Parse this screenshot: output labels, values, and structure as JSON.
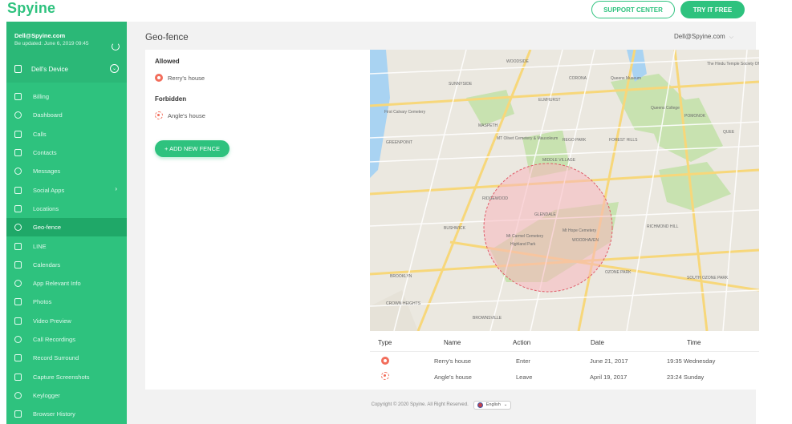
{
  "header": {
    "logo": "Spyine",
    "support_label": "SUPPORT CENTER",
    "try_label": "TRY IT FREE",
    "brand_color": "#2ec27e"
  },
  "sidebar": {
    "email": "Dell@Spyine.com",
    "updated": "Be updated: June 6, 2019 09:45",
    "device": "Dell's Device",
    "items": [
      {
        "label": "Billing",
        "icon": "billing-icon"
      },
      {
        "label": "Dashboard",
        "icon": "dashboard-icon"
      },
      {
        "label": "Calls",
        "icon": "phone-icon"
      },
      {
        "label": "Contacts",
        "icon": "contacts-icon"
      },
      {
        "label": "Messages",
        "icon": "message-icon"
      },
      {
        "label": "Social Apps",
        "icon": "social-icon"
      },
      {
        "label": "Locations",
        "icon": "location-icon"
      },
      {
        "label": "Geo-fence",
        "icon": "geofence-icon"
      },
      {
        "label": "LINE",
        "icon": "line-icon"
      },
      {
        "label": "Calendars",
        "icon": "calendar-icon"
      },
      {
        "label": "App Relevant Info",
        "icon": "apps-icon"
      },
      {
        "label": "Photos",
        "icon": "photo-icon"
      },
      {
        "label": "Video Preview",
        "icon": "video-icon"
      },
      {
        "label": "Call Recordings",
        "icon": "microphone-icon"
      },
      {
        "label": "Record Surround",
        "icon": "record-icon"
      },
      {
        "label": "Capture Screenshots",
        "icon": "screenshot-icon"
      },
      {
        "label": "Keylogger",
        "icon": "keyboard-icon"
      },
      {
        "label": "Browser History",
        "icon": "browser-icon"
      }
    ],
    "active_index": 7
  },
  "main": {
    "title": "Geo-fence",
    "user": "Dell@Spyine.com",
    "allowed_title": "Allowed",
    "allowed": [
      "Rerry's house"
    ],
    "forbidden_title": "Forbidden",
    "forbidden": [
      "Angle's house"
    ],
    "add_fence_label": "+ ADD NEW FENCE"
  },
  "map": {
    "labels": [
      "WOODSIDE",
      "SUNNYSIDE",
      "CORONA",
      "Queens Museum",
      "ELMHURST",
      "First Calvary Cemetery",
      "MASPETH",
      "GREENPOINT",
      "MT Olivet Cemetery & Mausoleum",
      "REGO PARK",
      "MIDDLE VILLAGE",
      "FOREST HILLS",
      "RIDGEWOOD",
      "GLENDALE",
      "BUSHWICK",
      "Mt Carmel Cemetery",
      "Mt Hope Cemetery",
      "Highland Park",
      "WOODHAVEN",
      "RICHMOND HILL",
      "BROOKLYN",
      "OZONE PARK",
      "SOUTH OZONE PARK",
      "CROWN HEIGHTS",
      "BROWNSVILLE",
      "Queens College",
      "POMONOK",
      "QUEE",
      "The Hindu Temple Society Of..."
    ]
  },
  "table": {
    "headers": [
      "Type",
      "Name",
      "Action",
      "Date",
      "Time"
    ],
    "rows": [
      {
        "type": "allowed",
        "name": "Rerry's house",
        "action": "Enter",
        "date": "June 21, 2017",
        "time": "19:35 Wednesday"
      },
      {
        "type": "forbidden",
        "name": "Angle's house",
        "action": "Leave",
        "date": "April 19, 2017",
        "time": "23:24 Sunday"
      }
    ]
  },
  "footer": {
    "copyright": "Copyright © 2020 Spyine. All Right Reserved.",
    "language": "English"
  }
}
